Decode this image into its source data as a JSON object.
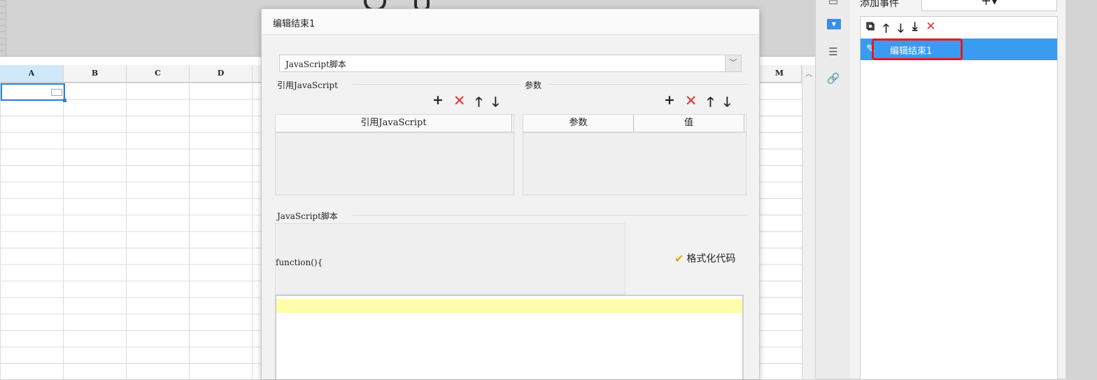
{
  "sheet": {
    "columns": [
      "A",
      "B",
      "C",
      "D",
      "M"
    ],
    "active_column": "A"
  },
  "dialog": {
    "title": "编辑结束1",
    "type_select": "JavaScript脚本",
    "ref_js_section": "引用JavaScript",
    "ref_js_column": "引用JavaScript",
    "params_section": "参数",
    "params_columns": [
      "参数",
      "值"
    ],
    "script_section": "JavaScript脚本",
    "function_signature": "function(){",
    "format_button": "格式化代码"
  },
  "event_panel": {
    "add_event_label": "添加事件",
    "add_button": "+▾",
    "events": [
      {
        "label": "编辑结束1",
        "selected": true
      }
    ]
  },
  "icons": {
    "toolbar_add": "+",
    "toolbar_delete": "✕",
    "toolbar_up": "🡑",
    "toolbar_down": "🡓"
  },
  "colors": {
    "selection_blue": "#3a9bf0",
    "highlight_red": "#e21c1c",
    "delete_red": "#e23232",
    "editor_current_line": "#fffdaa"
  }
}
